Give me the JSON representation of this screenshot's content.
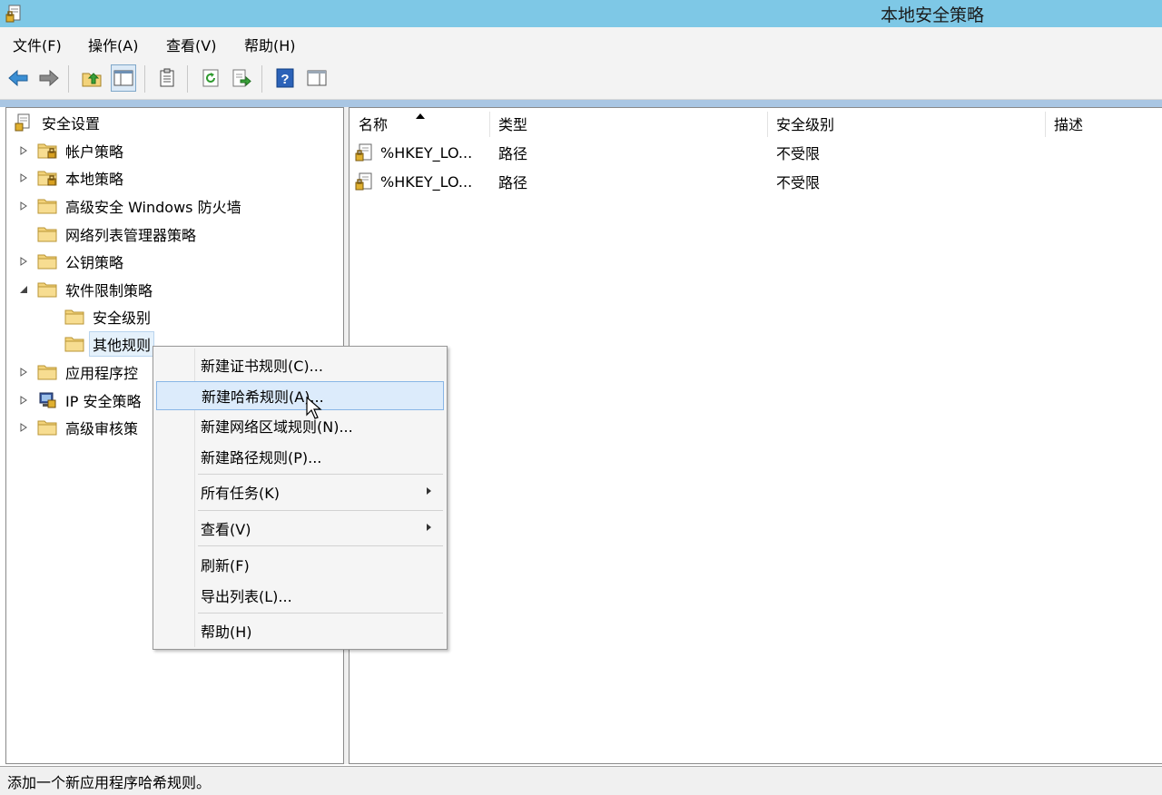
{
  "window": {
    "title": "本地安全策略",
    "app_icon": "local-security-policy-icon"
  },
  "menu": [
    "文件(F)",
    "操作(A)",
    "查看(V)",
    "帮助(H)"
  ],
  "toolbar": [
    "back-icon",
    "forward-icon",
    "up-folder-icon",
    "show-hide-console-tree-icon",
    "properties-icon",
    "refresh-icon",
    "export-list-icon",
    "help-icon",
    "show-hide-action-pane-icon"
  ],
  "tree": {
    "root": "安全设置",
    "items": [
      {
        "label": "帐户策略",
        "expander": "collapsed"
      },
      {
        "label": "本地策略",
        "expander": "collapsed"
      },
      {
        "label": "高级安全 Windows 防火墙",
        "expander": "collapsed"
      },
      {
        "label": "网络列表管理器策略",
        "expander": "none"
      },
      {
        "label": "公钥策略",
        "expander": "collapsed"
      },
      {
        "label": "软件限制策略",
        "expander": "expanded"
      },
      {
        "label": "安全级别",
        "expander": "none"
      },
      {
        "label": "其他规则",
        "expander": "none",
        "selected": true
      },
      {
        "label": "应用程序控",
        "expander": "collapsed"
      },
      {
        "label": "IP 安全策略",
        "expander": "collapsed"
      },
      {
        "label": "高级审核策",
        "expander": "collapsed"
      }
    ]
  },
  "list": {
    "columns": [
      "名称",
      "类型",
      "安全级别",
      "描述"
    ],
    "sort": {
      "column": "名称",
      "direction": "ascending"
    },
    "rows": [
      {
        "name": "%HKEY_LO...",
        "type": "路径",
        "level": "不受限",
        "desc": ""
      },
      {
        "name": "%HKEY_LO...",
        "type": "路径",
        "level": "不受限",
        "desc": ""
      }
    ]
  },
  "context_menu": {
    "items": [
      {
        "label": "新建证书规则(C)..."
      },
      {
        "label": "新建哈希规则(A)...",
        "highlighted": true
      },
      {
        "label": "新建网络区域规则(N)..."
      },
      {
        "label": "新建路径规则(P)..."
      },
      {
        "label": "所有任务(K)",
        "submenu": true
      },
      {
        "label": "查看(V)",
        "submenu": true
      },
      {
        "label": "刷新(F)"
      },
      {
        "label": "导出列表(L)..."
      },
      {
        "label": "帮助(H)"
      }
    ]
  },
  "status": "添加一个新应用程序哈希规则。",
  "colors": {
    "titlebar": "#7ec8e6",
    "menu_highlight": "#dcebfb",
    "folder": "#f3d37a"
  }
}
